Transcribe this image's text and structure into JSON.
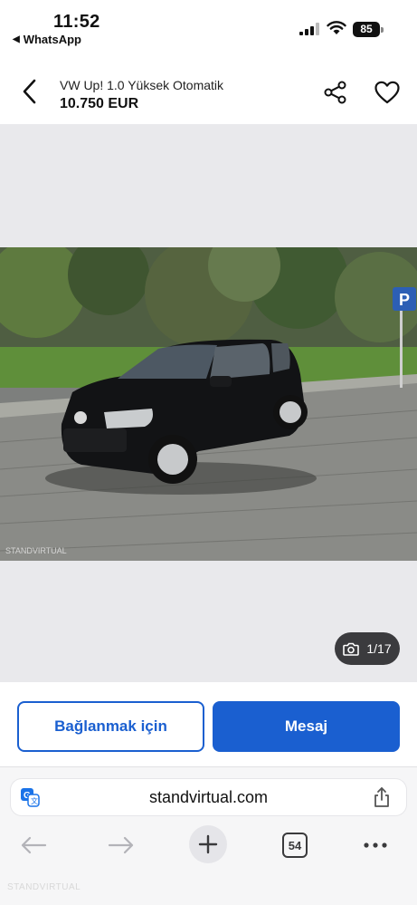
{
  "status_bar": {
    "time": "11:52",
    "back_app": "WhatsApp",
    "battery": "85"
  },
  "header": {
    "title": "VW Up! 1.0 Yüksek Otomatik",
    "price": "10.750 EUR"
  },
  "gallery": {
    "counter": "1/17",
    "photo_watermark": "STANDVIRTUAL"
  },
  "actions": {
    "connect_label": "Bağlanmak için",
    "message_label": "Mesaj",
    "accent_color": "#1a5fd0"
  },
  "browser": {
    "domain": "standvirtual.com",
    "tab_count": "54"
  },
  "footer_watermark": "STANDVIRTUAL",
  "icons": [
    "back-arrow-icon",
    "share-icon",
    "heart-icon",
    "camera-icon",
    "translate-icon",
    "share-up-icon",
    "nav-back-icon",
    "nav-forward-icon",
    "plus-icon",
    "more-icon"
  ]
}
